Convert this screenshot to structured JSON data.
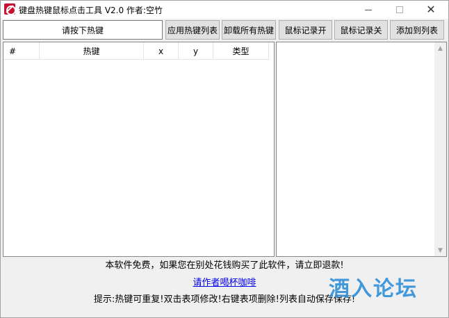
{
  "window": {
    "title": "键盘热键鼠标点击工具 V2.0 作者:空竹"
  },
  "titlebar_buttons": {
    "minimize_icon": "minimize-icon",
    "maximize_icon": "maximize-icon",
    "close_glyph": "✕"
  },
  "toolbar": {
    "hotkey_display": "请按下热键",
    "apply_label": "应用热键列表",
    "unload_label": "卸载所有热键",
    "record_on_label": "鼠标记录开",
    "record_off_label": "鼠标记录关",
    "add_label": "添加到列表"
  },
  "list": {
    "columns": [
      "#",
      "热键",
      "x",
      "y",
      "类型"
    ],
    "rows": []
  },
  "footer": {
    "notice": "本软件免费，如果您在别处花钱购买了此软件，请立即退款!",
    "coffee_link": "请作者喝杯咖啡",
    "hint": "提示:热键可重复!双击表项修改!右键表项删除!列表自动保存保存!",
    "watermark": "酒入论坛"
  },
  "colors": {
    "link": "#0000ee",
    "watermark": "#2f8fd8",
    "app_icon": "#c8102e"
  }
}
